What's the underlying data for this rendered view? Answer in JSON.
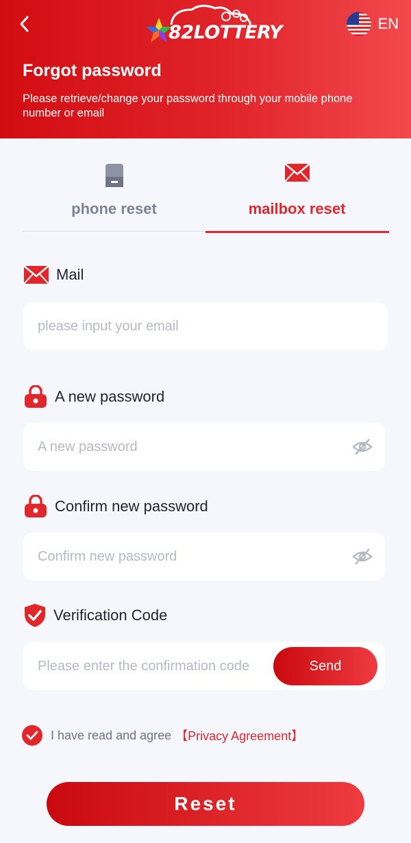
{
  "header": {
    "logo_text": "82LOTTERY",
    "language": "EN",
    "title": "Forgot password",
    "subtitle": "Please retrieve/change your password through your mobile phone number or email"
  },
  "tabs": [
    {
      "label": "phone reset",
      "icon": "phone-icon",
      "active": false
    },
    {
      "label": "mailbox reset",
      "icon": "mail-icon",
      "active": true
    }
  ],
  "form": {
    "mail": {
      "label": "Mail",
      "placeholder": "please input your email",
      "value": ""
    },
    "new_password": {
      "label": "A new password",
      "placeholder": "A new password",
      "value": ""
    },
    "confirm_password": {
      "label": "Confirm new password",
      "placeholder": "Confirm new password",
      "value": ""
    },
    "verification": {
      "label": "Verification Code",
      "placeholder": "Please enter the confirmation code",
      "value": "",
      "send_label": "Send"
    }
  },
  "agreement": {
    "text": "I have read and agree",
    "link": "【Privacy Agreement】",
    "checked": true
  },
  "reset_label": "Reset",
  "colors": {
    "primary": "#e1272c",
    "background": "#f5f7fc"
  }
}
